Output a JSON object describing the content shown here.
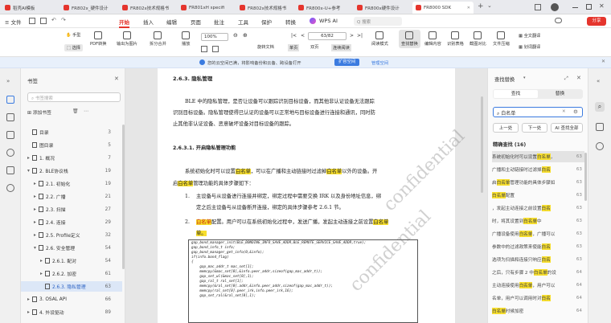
{
  "tabs": [
    {
      "label": "稻壳AI模板",
      "color": "#e5352d"
    },
    {
      "label": "FR802x_硬件设计",
      "color": "#e5352d"
    },
    {
      "label": "FR802x技术规格书",
      "color": "#e5352d"
    },
    {
      "label": "FR801xH specifi",
      "color": "#e5352d"
    },
    {
      "label": "FR802x技术规格书",
      "color": "#e5352d"
    },
    {
      "label": "FR800x-U+参考",
      "color": "#e5352d"
    },
    {
      "label": "FR800x硬件设计",
      "color": "#e5352d"
    },
    {
      "label": "FR8000 SDK",
      "color": "#e5352d"
    }
  ],
  "tabbar": {
    "add": "+",
    "dropdown": "⌄",
    "avatar": "●"
  },
  "menubar": {
    "file": "≡ 文件",
    "items": [
      "开始",
      "插入",
      "编辑",
      "页面",
      "批注",
      "工具",
      "保护",
      "转换"
    ],
    "wps_ai": "WPS AI",
    "search": "Q 搜索",
    "share": "分享"
  },
  "toolbar": {
    "hand": "手型",
    "select": "选择",
    "pdf_convert": "PDF转换",
    "export_img": "输出为图片",
    "split": "拆分合并",
    "play": "播放",
    "zoom": "100%",
    "page_current": "63/82",
    "rotate": "旋转文档",
    "single": "单页",
    "double": "双页",
    "continuous": "连续阅读",
    "read_mode": "阅读模式",
    "find_replace": "查找替换",
    "edit_content": "编辑内容",
    "ocr": "识别表格",
    "screenshot": "截图对比",
    "text_compare": "文件压缩",
    "translate": "划词翻译",
    "full_translate": "全文翻译"
  },
  "notice": {
    "text": "您的云空间已满，将影响备份和云备、跨设备打开",
    "expand": "扩容空间",
    "manage": "管理空间"
  },
  "bookmarks": {
    "title": "书签",
    "search_placeholder": "书签搜索",
    "add": "添加书签",
    "items": [
      {
        "label": "目录",
        "page": "3",
        "indent": 0,
        "arrow": ""
      },
      {
        "label": "图目录",
        "page": "5",
        "indent": 0,
        "arrow": ""
      },
      {
        "label": "1. 概况",
        "page": "7",
        "indent": 0,
        "arrow": "▸"
      },
      {
        "label": "2. BLE协议栈",
        "page": "19",
        "indent": 0,
        "arrow": "▾"
      },
      {
        "label": "2.1. 初始化",
        "page": "19",
        "indent": 1,
        "arrow": "▸"
      },
      {
        "label": "2.2. 广播",
        "page": "21",
        "indent": 1,
        "arrow": "▸"
      },
      {
        "label": "2.3. 扫描",
        "page": "27",
        "indent": 1,
        "arrow": "▸"
      },
      {
        "label": "2.4. 连接",
        "page": "29",
        "indent": 1,
        "arrow": "▸"
      },
      {
        "label": "2.5. Profile定义",
        "page": "32",
        "indent": 1,
        "arrow": "▸"
      },
      {
        "label": "2.6. 安全管理",
        "page": "54",
        "indent": 1,
        "arrow": "▾"
      },
      {
        "label": "2.6.1. 配对",
        "page": "54",
        "indent": 2,
        "arrow": "▸"
      },
      {
        "label": "2.6.2. 加密",
        "page": "61",
        "indent": 2,
        "arrow": "▸"
      },
      {
        "label": "2.6.3. 隐私管理",
        "page": "63",
        "indent": 2,
        "arrow": "",
        "sel": true
      },
      {
        "label": "3. OSAL API",
        "page": "66",
        "indent": 0,
        "arrow": "▸"
      },
      {
        "label": "4. 外设驱动",
        "page": "89",
        "indent": 0,
        "arrow": "▸"
      }
    ]
  },
  "document": {
    "h1": "2.6.3.  隐私管理",
    "p1a": "BLE 中的隐私管理，是否让设备可以跟踪识别目标设备，而其他非认证设备无法跟踪",
    "p1b": "识别目标设备。隐私管理使得已认证的设备可以正常地与目标设备进行连接和通讯，同时防",
    "p1c": "止其他非认证设备、恶意破坏设备对目标设备的跟踪。",
    "h2": "2.6.3.1.  开启隐私管理功能",
    "p2a_pre": "系统初始化时可以设置",
    "kw": "白名单",
    "p2a_mid": "，可以在广播和主动链接时过滤掉",
    "p2a_post": "以外的设备。开",
    "p2b_pre": "启",
    "p2b_post": "管理功能的具体步骤如下：",
    "li1_num": "1.",
    "li1a": "主设备与从设备进行连接并绑定，绑定过程中需要交换 IRK 以及身份地址信息，绑",
    "li1b": "定之后主设备与从设备断开连接，绑定的具体步骤参考 2.6.1 节。",
    "li2_num": "2.",
    "li2_post": "配置。用户可以在系统初始化过程中，发送广播，发起主动连接之前设置",
    "li2b": "单。",
    "watermark": "confidential",
    "code": [
      "gap_bond_manager_init(BLE_BONDING_INFO_SAVE_ADDR,BLE_REMOTE_SERVICE_SAVE_ADDR,true);",
      "gap_bond_info_t info;",
      "gap_bond_manager_get_info(0,&info);",
      "if(info.bond_flag)",
      "{",
      "    gap_mac_addr_t mac_set[1];",
      "    memcpy(&mac_set[0],&info.peer_addr,sizeof(gap_mac_addr_t));",
      "    gap_set_wl(&mac_set[0],1);",
      "    gap_ral_t ral_set[1];",
      "    memcpy(&ral_set[0].addr,&info.peer_addr,sizeof(gap_mac_addr_t));",
      "    memcpy(ral_set[0].peer_irk,info.peer_irk,16);",
      "    gap_set_ral(&ral_set[0],1);"
    ]
  },
  "find": {
    "title": "查找替换",
    "tab_find": "查找",
    "tab_replace": "替换",
    "query": "白名单",
    "prev": "上一处",
    "next": "下一处",
    "ai": "AI 查找全部",
    "results_title": "精确查找 (16)",
    "results": [
      {
        "pre": "系统初始化时可以设置",
        "kw": "白名单",
        "post": "，",
        "n": "63"
      },
      {
        "pre": "广播和主动链接时过滤掉",
        "kw": "白名",
        "post": "",
        "n": "63"
      },
      {
        "pre": "启",
        "kw": "白名单",
        "post": "管理功能的具体步骤如",
        "n": "63"
      },
      {
        "pre": "",
        "kw": "白名单",
        "post": "配置",
        "n": "63"
      },
      {
        "pre": "，发起主动连接之前设置",
        "kw": "白名",
        "post": "",
        "n": "63"
      },
      {
        "pre": "时，将其设置到",
        "kw": "白名单",
        "post": "中",
        "n": "63"
      },
      {
        "pre": "广播设备使用",
        "kw": "白名单",
        "post": "，广播可以",
        "n": "63"
      },
      {
        "pre": "参数中的过滤政策来使能",
        "kw": "白名",
        "post": "",
        "n": "63"
      },
      {
        "pre": "选项为扫描和连接只响应",
        "kw": "白名",
        "post": "",
        "n": "63"
      },
      {
        "pre": "之后，只有步骤 2 中",
        "kw": "白名单",
        "post": "的设",
        "n": "64"
      },
      {
        "pre": "主动连接使用",
        "kw": "白名单",
        "post": "，用户可以",
        "n": "64"
      },
      {
        "pre": "名单，用户可以调用时对",
        "kw": "白名",
        "post": "",
        "n": "64"
      },
      {
        "pre": "",
        "kw": "白名单",
        "post": "时候加密",
        "n": "64"
      }
    ]
  }
}
